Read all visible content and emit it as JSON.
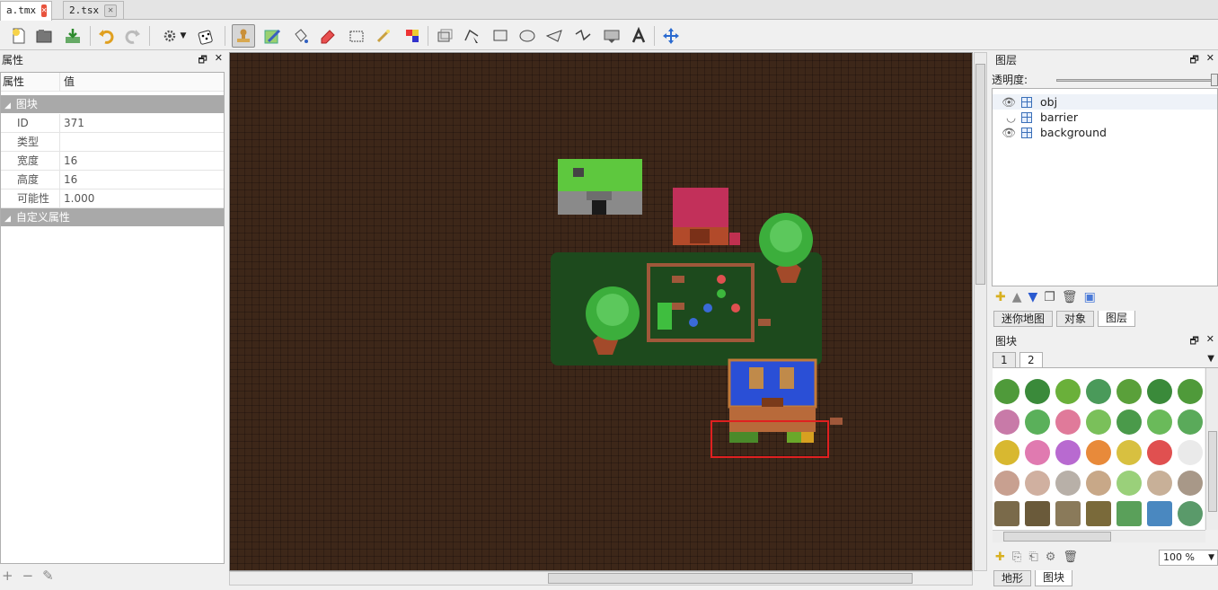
{
  "tabs": [
    {
      "label": "a.tmx"
    },
    {
      "label": "2.tsx"
    }
  ],
  "tab_close": "✕",
  "properties": {
    "title": "属性",
    "col_name": "属性",
    "col_value": "值",
    "group_tile": "图块",
    "rows": [
      {
        "name": "ID",
        "value": "371"
      },
      {
        "name": "类型",
        "value": ""
      },
      {
        "name": "宽度",
        "value": "16"
      },
      {
        "name": "高度",
        "value": "16"
      },
      {
        "name": "可能性",
        "value": "1.000"
      }
    ],
    "group_custom": "自定义属性",
    "footer_icons": [
      "plus-icon",
      "minus-icon",
      "pencil-icon"
    ]
  },
  "layers_panel": {
    "title": "图层",
    "opacity_label": "透明度:",
    "layers": [
      {
        "name": "obj",
        "visible": true,
        "selected": true
      },
      {
        "name": "barrier",
        "visible": false
      },
      {
        "name": "background",
        "visible": true
      }
    ],
    "bottom_tabs": [
      "迷你地图",
      "对象",
      "图层"
    ]
  },
  "tiles_panel": {
    "title": "图块",
    "sheet_tabs": [
      "1",
      "2"
    ],
    "zoom": "100 %",
    "bottom_tabs": [
      "地形",
      "图块"
    ]
  },
  "colors": {
    "map_bg": "#3d2719",
    "selection": "#e02020",
    "grass": "#1d4a1d",
    "roof_blue": "#2a4fd6",
    "roof_red": "#c2305a",
    "roof_green": "#59c83c"
  }
}
